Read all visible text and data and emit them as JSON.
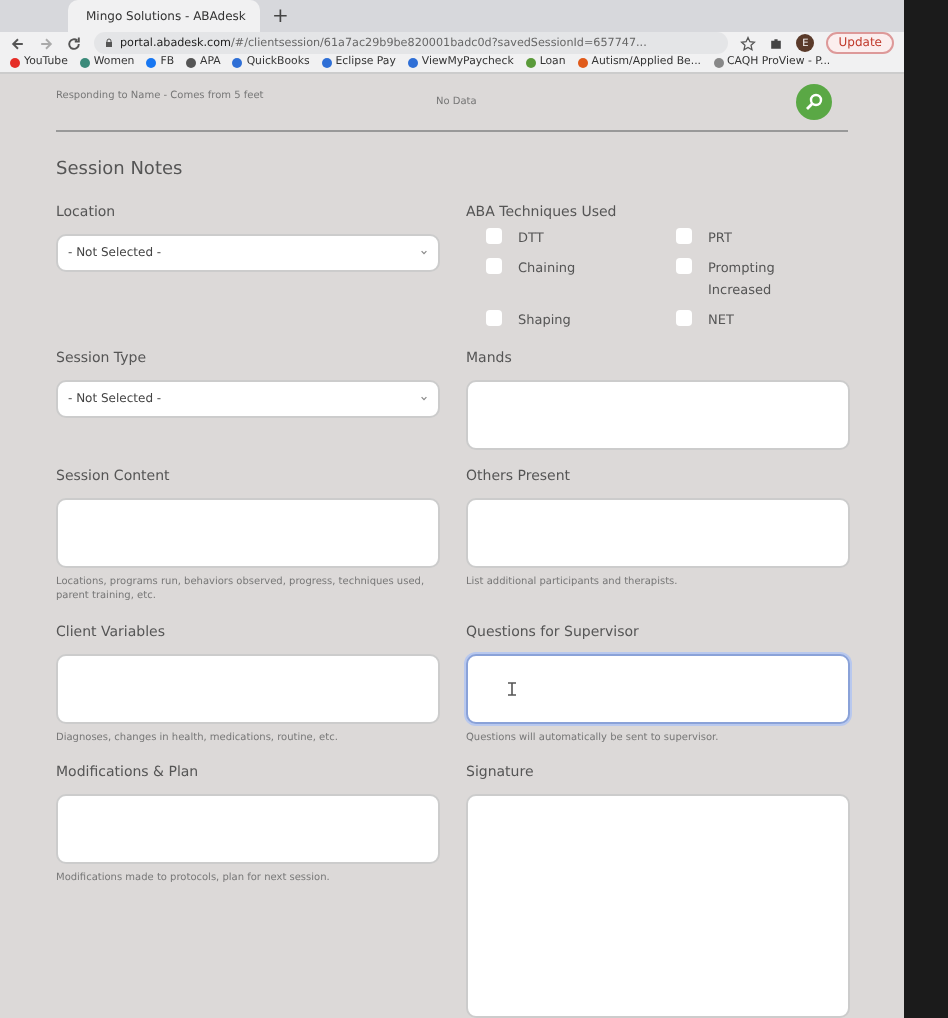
{
  "browser": {
    "tab_title": "Mingo Solutions - ABAdesk",
    "new_tab": "+",
    "url_host": "portal.abadesk.com",
    "url_path": "/#/clientsession/61a7ac29b9be820001badc0d?savedSessionId=657747...",
    "profile": "E",
    "update_label": "Update",
    "bookmarks": [
      {
        "label": "YouTube",
        "color": "#e52d27"
      },
      {
        "label": "Women",
        "color": "#3b8a7a"
      },
      {
        "label": "FB",
        "color": "#1877f2"
      },
      {
        "label": "APA",
        "color": "#555555"
      },
      {
        "label": "QuickBooks",
        "color": "#2f6fd6"
      },
      {
        "label": "Eclipse Pay",
        "color": "#2f6fd6"
      },
      {
        "label": "ViewMyPaycheck",
        "color": "#2f6fd6"
      },
      {
        "label": "Loan",
        "color": "#5a9a3a"
      },
      {
        "label": "Autism/Applied Be...",
        "color": "#e05a1a"
      },
      {
        "label": "CAQH ProView - P...",
        "color": "#888888"
      }
    ]
  },
  "top_row": {
    "label": "Responding to Name - Comes from 5 feet",
    "value": "No Data"
  },
  "section_title": "Session Notes",
  "fields": [
    {
      "kind": "select",
      "label": "Location",
      "value": "- Not Selected -"
    },
    {
      "kind": "checkboxes",
      "label": "ABA Techniques Used",
      "options": [
        {
          "label": "DTT",
          "checked": false
        },
        {
          "label": "PRT",
          "checked": false
        },
        {
          "label": "Chaining",
          "checked": false
        },
        {
          "label": "Prompting Increased",
          "checked": false
        },
        {
          "label": "Shaping",
          "checked": false
        },
        {
          "label": "NET",
          "checked": false
        }
      ]
    },
    {
      "kind": "select",
      "label": "Session Type",
      "value": "- Not Selected -"
    },
    {
      "kind": "textarea",
      "label": "Mands",
      "focused": false
    },
    {
      "kind": "textarea",
      "label": "Session Content",
      "hint": "Locations, programs run, behaviors observed, progress, techniques used, parent training, etc.",
      "focused": false
    },
    {
      "kind": "textarea",
      "label": "Others Present",
      "hint": "List additional participants and therapists.",
      "focused": false
    },
    {
      "kind": "textarea",
      "label": "Client Variables",
      "hint": "Diagnoses, changes in health, medications, routine, etc.",
      "focused": false
    },
    {
      "kind": "textarea",
      "label": "Questions for Supervisor",
      "hint": "Questions will automatically be sent to supervisor.",
      "focused": true
    },
    {
      "kind": "textarea",
      "label": "Modifications & Plan",
      "hint": "Modifications made to protocols, plan for next session.",
      "focused": false
    },
    {
      "kind": "signature",
      "label": "Signature"
    }
  ]
}
